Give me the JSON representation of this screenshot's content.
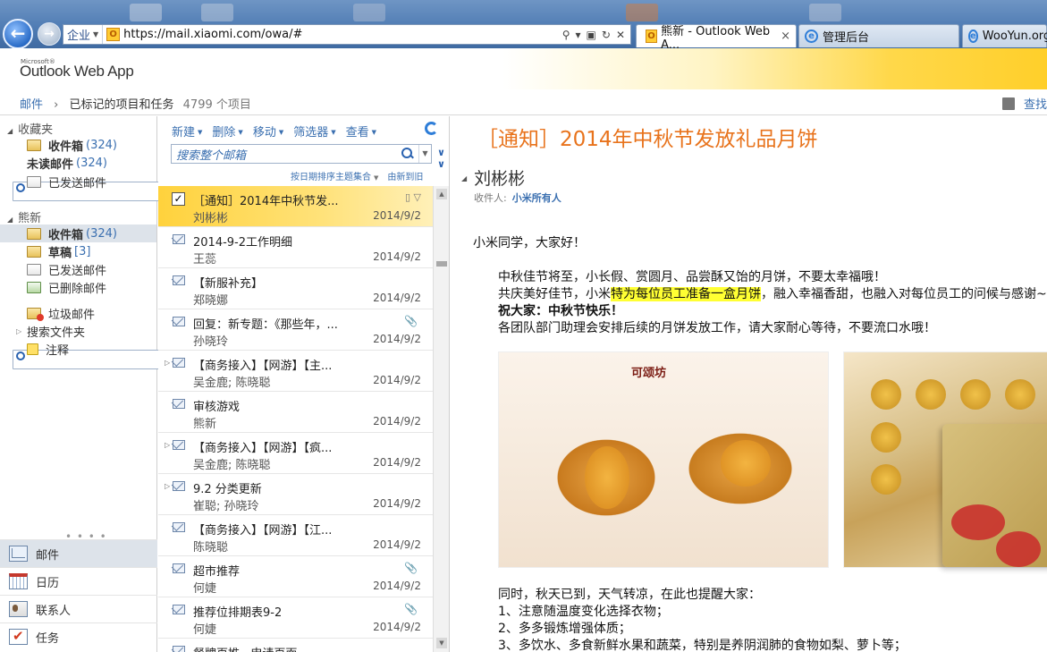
{
  "browser": {
    "zone_label": "企业",
    "url": "https://mail.xiaomi.com/owa/#",
    "tabs": [
      {
        "label": "熊新 - Outlook Web A...",
        "close": "×"
      },
      {
        "label": "管理后台"
      },
      {
        "label": "WooYun.org"
      }
    ]
  },
  "app": {
    "brand_small": "Microsoft®",
    "brand": "Outlook Web App"
  },
  "breadcrumb": {
    "root": "邮件",
    "current": "已标记的项目和任务",
    "count": "4799 个项目",
    "find_someone": "查找"
  },
  "folders": {
    "favorites_title": "收藏夹",
    "favorites": [
      {
        "label": "收件箱",
        "count": "(324)",
        "bold": true
      },
      {
        "label": "未读邮件",
        "count": "(324)",
        "bold": true
      },
      {
        "label": "已发送邮件",
        "count": ""
      }
    ],
    "account_title": "熊新",
    "account": [
      {
        "label": "收件箱",
        "count": "(324)",
        "bold": true
      },
      {
        "label": "草稿",
        "count": "[3]",
        "bold": true
      },
      {
        "label": "已发送邮件",
        "count": ""
      },
      {
        "label": "已删除邮件",
        "count": ""
      }
    ],
    "extra": [
      {
        "label": "垃圾邮件"
      },
      {
        "label": "搜索文件夹"
      },
      {
        "label": "注释"
      }
    ],
    "splitter": "• • • •"
  },
  "nav": [
    {
      "label": "邮件",
      "icon": "mail-icon"
    },
    {
      "label": "日历",
      "icon": "calendar-icon"
    },
    {
      "label": "联系人",
      "icon": "contacts-icon"
    },
    {
      "label": "任务",
      "icon": "tasks-icon"
    }
  ],
  "toolbar": {
    "new": "新建",
    "delete": "删除",
    "move": "移动",
    "filter": "筛选器",
    "view": "查看"
  },
  "search": {
    "placeholder": "搜索整个邮箱"
  },
  "sort": {
    "by": "按日期排序主题集合",
    "order": "由新到旧"
  },
  "messages": [
    {
      "subject": "［通知］2014年中秋节发...",
      "from": "刘彬彬",
      "date": "2014/9/2",
      "selected": true
    },
    {
      "subject": "2014-9-2工作明细",
      "from": "王蕊",
      "date": "2014/9/2"
    },
    {
      "subject": "【新服补充】",
      "from": "郑晓娜",
      "date": "2014/9/2"
    },
    {
      "subject": "回复：新专题：《那些年，...",
      "from": "孙晓玲",
      "date": "2014/9/2",
      "attach": true
    },
    {
      "subject": "【商务接入】【网游】【主...",
      "from": "吴金鹿; 陈晓聪",
      "date": "2014/9/2",
      "thread": true
    },
    {
      "subject": "审核游戏",
      "from": "熊新",
      "date": "2014/9/2"
    },
    {
      "subject": "【商务接入】【网游】【疯...",
      "from": "吴金鹿; 陈晓聪",
      "date": "2014/9/2",
      "thread": true
    },
    {
      "subject": "9.2 分类更新",
      "from": "崔聪; 孙晓玲",
      "date": "2014/9/2",
      "thread": true
    },
    {
      "subject": "【商务接入】【网游】【江...",
      "from": "陈晓聪",
      "date": "2014/9/2"
    },
    {
      "subject": "超市推荐",
      "from": "何婕",
      "date": "2014/9/2",
      "attach": true
    },
    {
      "subject": "推荐位排期表9-2",
      "from": "何婕",
      "date": "2014/9/2",
      "attach": true
    },
    {
      "subject": "餐牌页推...申请页面",
      "from": "",
      "date": ""
    }
  ],
  "reading": {
    "subject": "［通知］2014年中秋节发放礼品月饼",
    "sender": "刘彬彬",
    "to_label": "收件人:",
    "to": "小米所有人",
    "greeting": "小米同学，大家好！",
    "p1": "中秋佳节将至，小长假、赏圆月、品尝酥又饴的月饼，不要太幸福哦！",
    "p2_a": "共庆美好佳节，小米",
    "p2_hl": "特为每位员工准备一盒月饼",
    "p2_b": "，融入幸福香甜，也融入对每位员工的问候与感谢~",
    "p3": "祝大家：中秋节快乐！",
    "p4": "各团队部门助理会安排后续的月饼发放工作，请大家耐心等待，不要流口水哦！",
    "image_brand": "可颂坊",
    "p5": "同时，秋天已到，天气转凉，在此也提醒大家：",
    "tips": [
      "1、注意随温度变化选择衣物；",
      "2、多多锻炼增强体质；",
      "3、多饮水、多食新鲜水果和蔬菜，特别是养阴润肺的食物如梨、萝卜等；"
    ]
  }
}
